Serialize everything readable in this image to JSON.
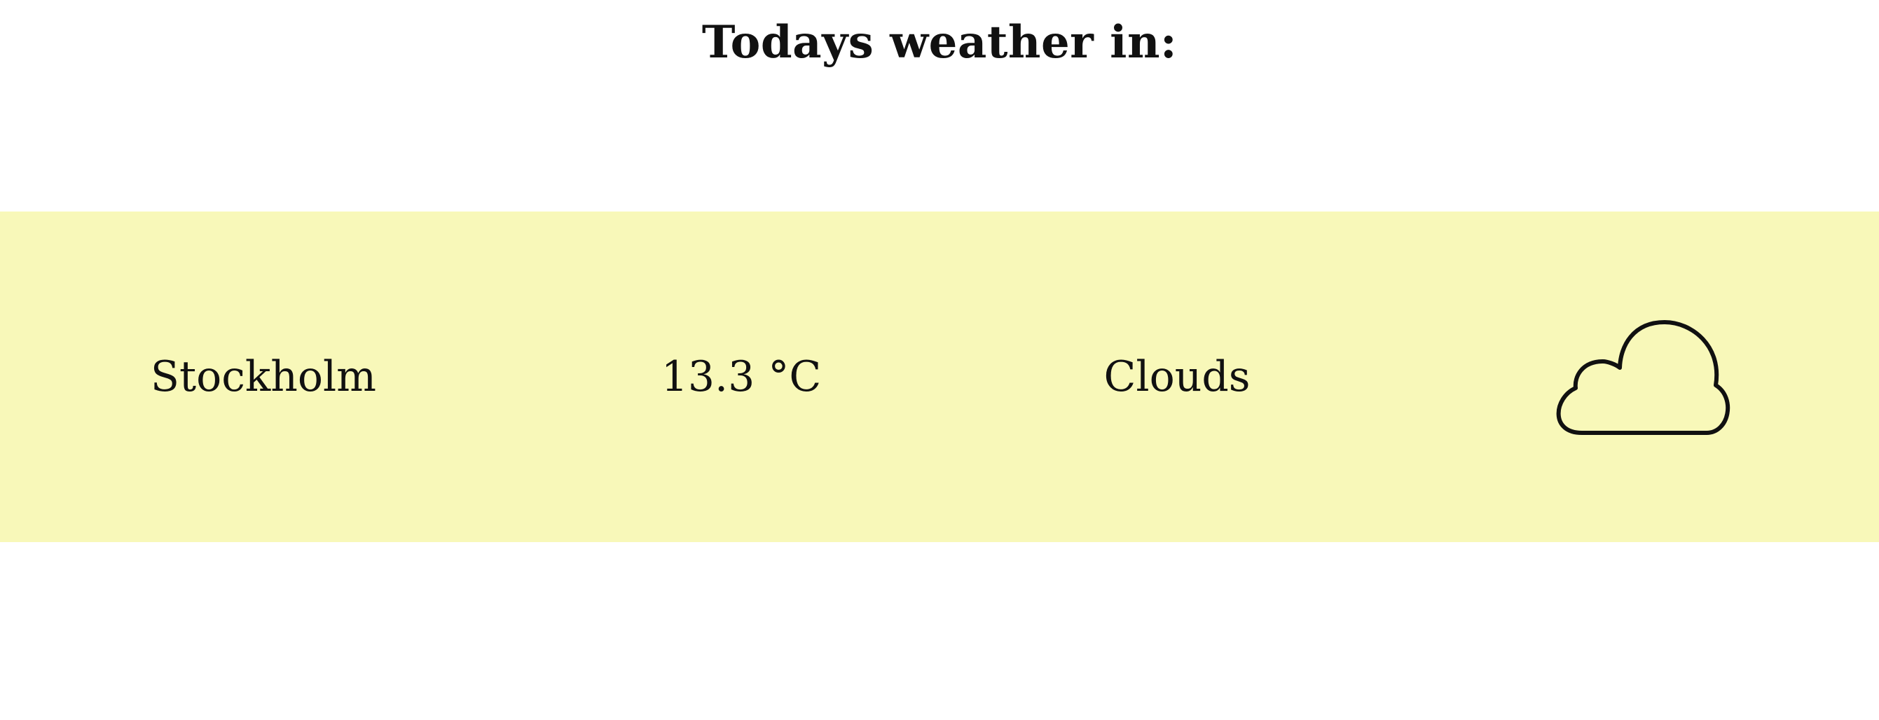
{
  "header": {
    "title": "Todays weather in:"
  },
  "weather": {
    "city": "Stockholm",
    "temperature": "13.3 °C",
    "condition": "Clouds",
    "icon": "cloud-icon"
  },
  "colors": {
    "band_background": "#f8f8b9",
    "text": "#111111",
    "page_background": "#ffffff"
  }
}
